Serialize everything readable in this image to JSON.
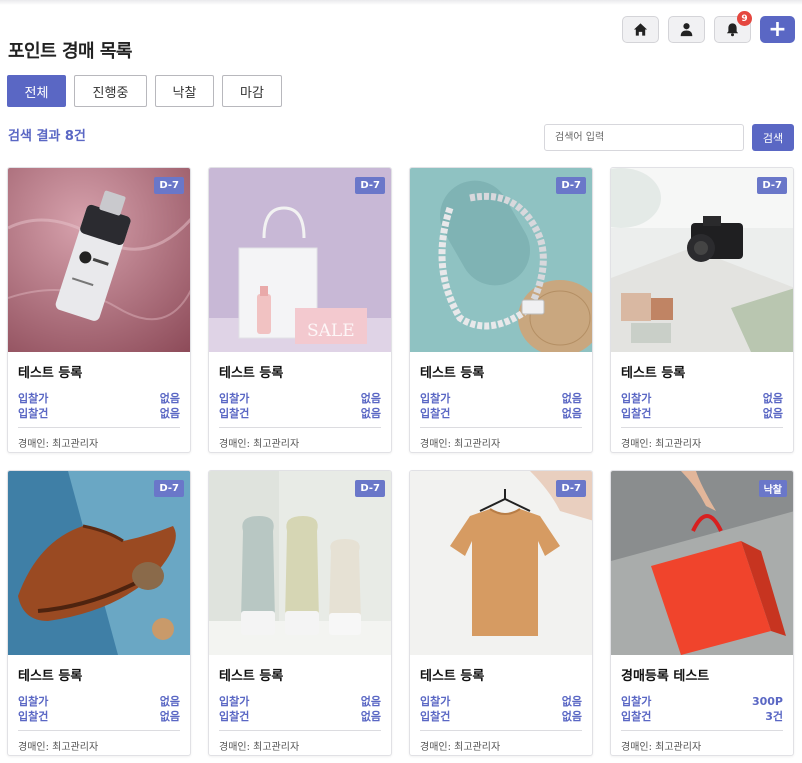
{
  "header": {
    "home_icon": "home-icon",
    "user_icon": "user-icon",
    "bell_icon": "bell-icon",
    "notification_count": "9",
    "add_label": "+"
  },
  "page": {
    "title": "포인트 경매 목록"
  },
  "filters": [
    {
      "label": "전체",
      "active": true
    },
    {
      "label": "진행중",
      "active": false
    },
    {
      "label": "낙찰",
      "active": false
    },
    {
      "label": "마감",
      "active": false
    }
  ],
  "search": {
    "result_text": "검색 결과 8건",
    "placeholder": "검색어 입력",
    "button_label": "검색"
  },
  "colors": {
    "accent": "#5a67c4",
    "badge": "#e5473f"
  },
  "cards": [
    {
      "tag": "D-7",
      "title": "테스트 등록",
      "price_label": "입찰가",
      "price_value": "없음",
      "count_label": "입찰건",
      "count_value": "없음",
      "seller": "경매인: 최고관리자",
      "image": "serum-bottle-photo"
    },
    {
      "tag": "D-7",
      "title": "테스트 등록",
      "price_label": "입찰가",
      "price_value": "없음",
      "count_label": "입찰건",
      "count_value": "없음",
      "seller": "경매인: 최고관리자",
      "image": "shopping-bag-sale-photo",
      "image_text": "SALE"
    },
    {
      "tag": "D-7",
      "title": "테스트 등록",
      "price_label": "입찰가",
      "price_value": "없음",
      "count_label": "입찰건",
      "count_value": "없음",
      "seller": "경매인: 최고관리자",
      "image": "silver-chain-photo"
    },
    {
      "tag": "D-7",
      "title": "테스트 등록",
      "price_label": "입찰가",
      "price_value": "없음",
      "count_label": "입찰건",
      "count_value": "없음",
      "seller": "경매인: 최고관리자",
      "image": "camera-photo"
    },
    {
      "tag": "D-7",
      "title": "테스트 등록",
      "price_label": "입찰가",
      "price_value": "없음",
      "count_label": "입찰건",
      "count_value": "없음",
      "seller": "경매인: 최고관리자",
      "image": "leather-shoe-photo"
    },
    {
      "tag": "D-7",
      "title": "테스트 등록",
      "price_label": "입찰가",
      "price_value": "없음",
      "count_label": "입찰건",
      "count_value": "없음",
      "seller": "경매인: 최고관리자",
      "image": "cosmetic-tubes-photo"
    },
    {
      "tag": "D-7",
      "title": "테스트 등록",
      "price_label": "입찰가",
      "price_value": "없음",
      "count_label": "입찰건",
      "count_value": "없음",
      "seller": "경매인: 최고관리자",
      "image": "tshirt-hanger-photo"
    },
    {
      "tag": "낙찰",
      "title": "경매등록 테스트",
      "price_label": "입찰가",
      "price_value": "300P",
      "count_label": "입찰건",
      "count_value": "3건",
      "seller": "경매인: 최고관리자",
      "image": "red-shopping-bag-photo"
    }
  ]
}
